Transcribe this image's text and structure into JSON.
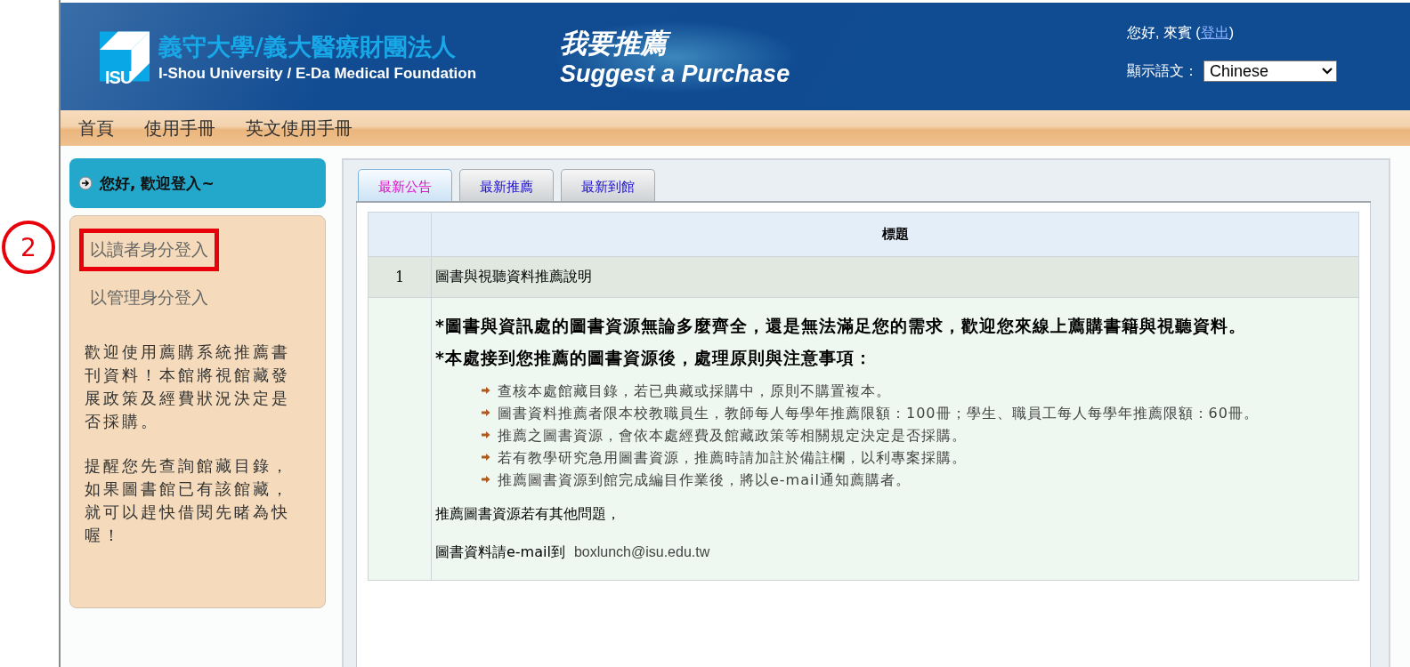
{
  "header": {
    "org_name_zh": "義守大學/義大醫療財團法人",
    "org_name_en": "I-Shou University / E-Da Medical Foundation",
    "logo_text": "ISU",
    "title_zh": "我要推薦",
    "title_en": "Suggest a Purchase",
    "greeting": "您好, 來賓 (",
    "logout_link": "登出",
    "greeting_end": ")",
    "language_label": "顯示語文：",
    "language": {
      "value": "Chinese"
    }
  },
  "nav": [
    "首頁",
    "使用手冊",
    "英文使用手冊"
  ],
  "sidebar": {
    "title": "您好, 歡迎登入~",
    "links": [
      {
        "label": "以讀者身分登入",
        "highlighted": true
      },
      {
        "label": "以管理身分登入",
        "highlighted": false
      }
    ],
    "paragraphs": [
      "歡迎使用薦購系統推薦書刊資料！本館將視館藏發展政策及經費狀況決定是否採購。",
      "提醒您先查詢館藏目錄，如果圖書館已有該館藏，就可以趕快借閱先睹為快喔！"
    ]
  },
  "annotation": {
    "label": "2"
  },
  "tabs": [
    {
      "label": "最新公告",
      "selected": true
    },
    {
      "label": "最新推薦",
      "selected": false
    },
    {
      "label": "最新到館",
      "selected": false
    }
  ],
  "table": {
    "columns": [
      "標題"
    ],
    "rows": [
      {
        "index": "1",
        "title": "圖書與視聽資料推薦說明"
      }
    ]
  },
  "notice": {
    "intro": "*圖書與資訊處的圖書資源無論多麼齊全，還是無法滿足您的需求，歡迎您來線上薦購書籍與視聽資料。",
    "rules_heading": "*本處接到您推薦的圖書資源後，處理原則與注意事項：",
    "rules": [
      "查核本處館藏目錄，若已典藏或採購中，原則不購置複本。",
      "圖書資料推薦者限本校教職員生，教師每人每學年推薦限額：100冊；學生、職員工每人每學年推薦限額：60冊。",
      "推薦之圖書資源，會依本處經費及館藏政策等相關規定決定是否採購。",
      "若有教學研究急用圖書資源，推薦時請加註於備註欄，以利專案採購。",
      "推薦圖書資源到館完成編目作業後，將以e-mail通知薦購者。"
    ],
    "contact_heading": "推薦圖書資源若有其他問題，",
    "contact_label": "圖書資料請e-mail到",
    "contact_email": "boxlunch@isu.edu.tw"
  }
}
